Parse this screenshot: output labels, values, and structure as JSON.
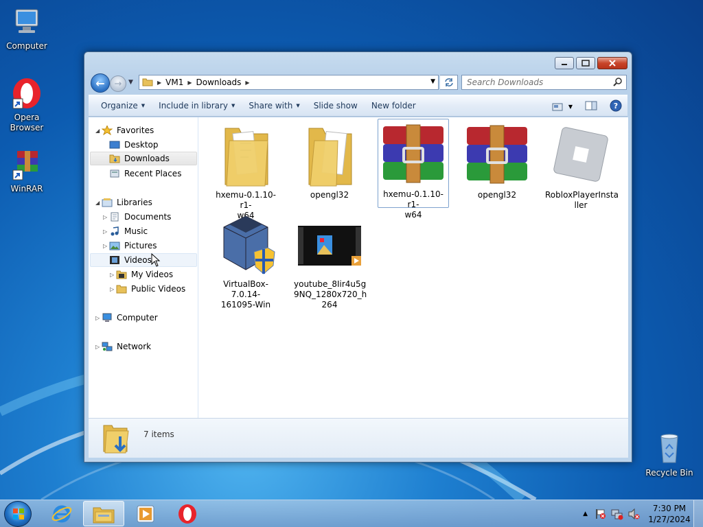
{
  "desktop": {
    "icons": [
      {
        "label": "Computer"
      },
      {
        "label": "Opera\nBrowser"
      },
      {
        "label": "WinRAR"
      },
      {
        "label": "Recycle Bin"
      }
    ]
  },
  "window": {
    "address": {
      "crumbs": [
        "VM1",
        "Downloads"
      ]
    },
    "search_placeholder": "Search Downloads",
    "toolbar": {
      "organize": "Organize",
      "include_in_library": "Include in library",
      "share_with": "Share with",
      "slide_show": "Slide show",
      "new_folder": "New folder"
    },
    "nav": {
      "favorites": "Favorites",
      "desktop": "Desktop",
      "downloads": "Downloads",
      "recent_places": "Recent Places",
      "libraries": "Libraries",
      "documents": "Documents",
      "music": "Music",
      "pictures": "Pictures",
      "videos": "Videos",
      "my_videos": "My Videos",
      "public_videos": "Public Videos",
      "computer": "Computer",
      "network": "Network"
    },
    "files": [
      {
        "name": "hxemu-0.1.10-r1-\nw64",
        "type": "folder"
      },
      {
        "name": "opengl32",
        "type": "folder"
      },
      {
        "name": "hxemu-0.1.10-r1-\nw64",
        "type": "winrar"
      },
      {
        "name": "opengl32",
        "type": "winrar"
      },
      {
        "name": "RobloxPlayerInsta\nller",
        "type": "roblox"
      },
      {
        "name": "VirtualBox-7.0.14-\n161095-Win",
        "type": "virtualbox"
      },
      {
        "name": "youtube_8Iir4u5g\n9NQ_1280x720_h\n264",
        "type": "video"
      }
    ],
    "details": {
      "item_count": "7 items"
    }
  },
  "taskbar": {
    "clock": {
      "time": "7:30 PM",
      "date": "1/27/2024"
    }
  },
  "colors": {
    "accent": "#1e395b",
    "selection_border": "#7da2ce"
  }
}
